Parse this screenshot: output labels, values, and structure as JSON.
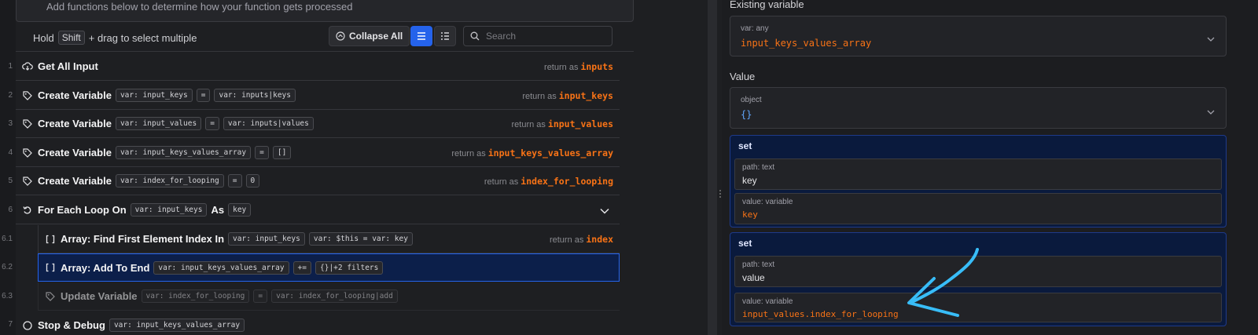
{
  "top_hint": "Add functions below to determine how your function gets processed",
  "toolbar": {
    "hint_before": "Hold",
    "hint_key": "Shift",
    "hint_after": "+ drag to select multiple",
    "collapse_label": "Collapse All",
    "search_placeholder": "Search"
  },
  "rows": [
    {
      "num": "1",
      "title": "Get All Input",
      "return_label": "return as",
      "return_var": "inputs",
      "icon": "cloud-download-icon"
    },
    {
      "num": "2",
      "title": "Create Variable",
      "chip1": "var: input_keys",
      "op": "=",
      "chip2": "var: inputs|keys",
      "return_label": "return as",
      "return_var": "input_keys",
      "icon": "tag-icon"
    },
    {
      "num": "3",
      "title": "Create Variable",
      "chip1": "var: input_values",
      "op": "=",
      "chip2": "var: inputs|values",
      "return_label": "return as",
      "return_var": "input_values",
      "icon": "tag-icon"
    },
    {
      "num": "4",
      "title": "Create Variable",
      "chip1": "var: input_keys_values_array",
      "op": "=",
      "chip2": "[]",
      "return_label": "return as",
      "return_var": "input_keys_values_array",
      "icon": "tag-icon"
    },
    {
      "num": "5",
      "title": "Create Variable",
      "chip1": "var: index_for_looping",
      "op": "=",
      "chip2": "0",
      "return_label": "return as",
      "return_var": "index_for_looping",
      "icon": "tag-icon"
    },
    {
      "num": "6",
      "title": "For Each Loop On",
      "chip1": "var: input_keys",
      "as_word": "As",
      "chip2": "key",
      "icon": "loop-icon"
    },
    {
      "num": "6.1",
      "title": "Array: Find First Element Index In",
      "chip1": "var: input_keys",
      "chip2": "var: $this = var: key",
      "return_label": "return as",
      "return_var": "index",
      "icon": "brackets-icon"
    },
    {
      "num": "6.2",
      "title": "Array: Add To End",
      "chip1": "var: input_keys_values_array",
      "op": "+=",
      "chip2": "{}|+2 filters",
      "icon": "brackets-icon"
    },
    {
      "num": "6.3",
      "title": "Update Variable",
      "chip1": "var: index_for_looping",
      "op": "=",
      "chip2": "var: index_for_looping|add",
      "icon": "tag-icon"
    },
    {
      "num": "7",
      "title": "Stop & Debug",
      "chip1": "var: input_keys_values_array",
      "icon": "stop-icon"
    }
  ],
  "panel": {
    "existing_label": "Existing variable",
    "existing_sub": "var: any",
    "existing_value": "input_keys_values_array",
    "value_label": "Value",
    "value_sub": "object",
    "value_value": "{}",
    "sets": [
      {
        "label": "set",
        "path_sub": "path: text",
        "path_value": "key",
        "value_sub": "value: variable",
        "value_value": "key"
      },
      {
        "label": "set",
        "path_sub": "path: text",
        "path_value": "value",
        "value_sub": "value: variable",
        "value_value": "input_values.index_for_looping"
      }
    ]
  },
  "colors": {
    "accent_blue": "#2563eb",
    "return_orange": "#f97316",
    "arrow_cyan": "#38bdf8"
  }
}
